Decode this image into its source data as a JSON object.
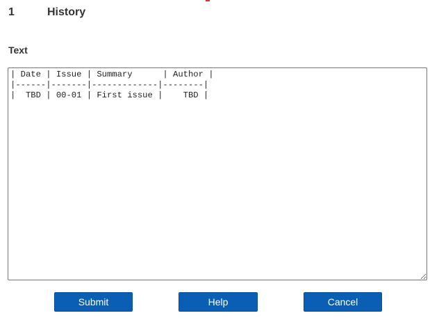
{
  "section": {
    "number": "1",
    "title": "History"
  },
  "field": {
    "label": "Text",
    "value": "| Date | Issue | Summary      | Author |\n|------|-------|-------------|--------|\n|  TBD | 00-01 | First issue |    TBD |"
  },
  "buttons": {
    "submit": "Submit",
    "help": "Help",
    "cancel": "Cancel"
  },
  "colors": {
    "button_bg": "#0a5fb5",
    "button_text": "#ffffff",
    "heading_text": "#333333",
    "accent_red": "#e0312b"
  }
}
